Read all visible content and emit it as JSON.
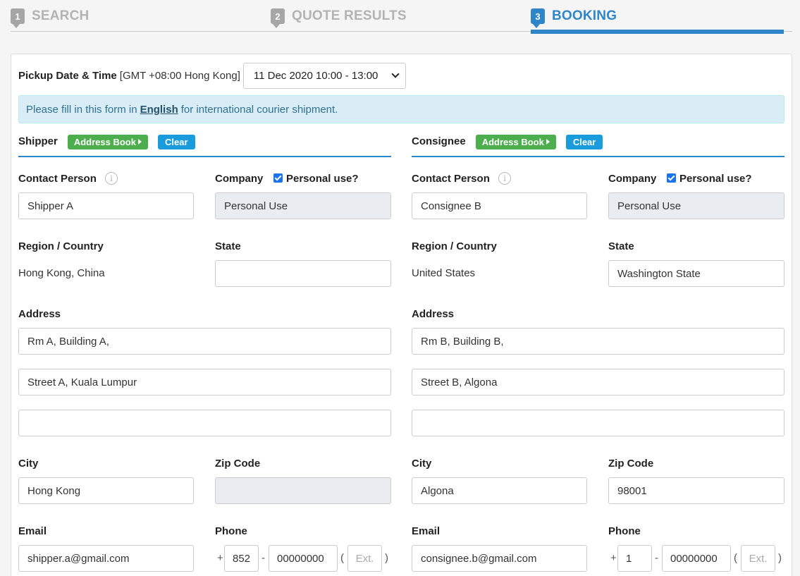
{
  "stepper": {
    "steps": [
      {
        "number": "1",
        "label": "SEARCH"
      },
      {
        "number": "2",
        "label": "QUOTE RESULTS"
      },
      {
        "number": "3",
        "label": "BOOKING"
      }
    ]
  },
  "pickup": {
    "label": "Pickup Date & Time",
    "timezone": "[GMT +08:00 Hong Kong]",
    "selected": "11 Dec 2020 10:00 - 13:00"
  },
  "info_bar": {
    "prefix": "Please fill in this form in",
    "link": "English",
    "suffix": "for international courier shipment."
  },
  "buttons": {
    "address_book": "Address Book",
    "clear": "Clear"
  },
  "labels": {
    "contact_person": "Contact Person",
    "company": "Company",
    "personal_use": "Personal use?",
    "region": "Region / Country",
    "state": "State",
    "address": "Address",
    "city": "City",
    "zip": "Zip Code",
    "email": "Email",
    "phone": "Phone",
    "ext_placeholder": "Ext."
  },
  "shipper": {
    "title": "Shipper",
    "contact_person": "Shipper A",
    "company": "Personal Use",
    "region": "Hong Kong, China",
    "state": "",
    "address1": "Rm A, Building A,",
    "address2": "Street A, Kuala Lumpur",
    "address3": "",
    "city": "Hong Kong",
    "zip": "",
    "email": "shipper.a@gmail.com",
    "phone_code": "852",
    "phone_number": "00000000"
  },
  "consignee": {
    "title": "Consignee",
    "contact_person": "Consignee B",
    "company": "Personal Use",
    "region": "United States",
    "state": "Washington State",
    "address1": "Rm B, Building B,",
    "address2": "Street B, Algona",
    "address3": "",
    "city": "Algona",
    "zip": "98001",
    "email": "consignee.b@gmail.com",
    "phone_code": "1",
    "phone_number": "00000000"
  },
  "colors": {
    "primary": "#2e86c8",
    "green_button": "#4cae4c",
    "blue_button": "#1a9bdc",
    "info_bg": "#d9edf7",
    "disabled_input": "#e9edf1"
  }
}
